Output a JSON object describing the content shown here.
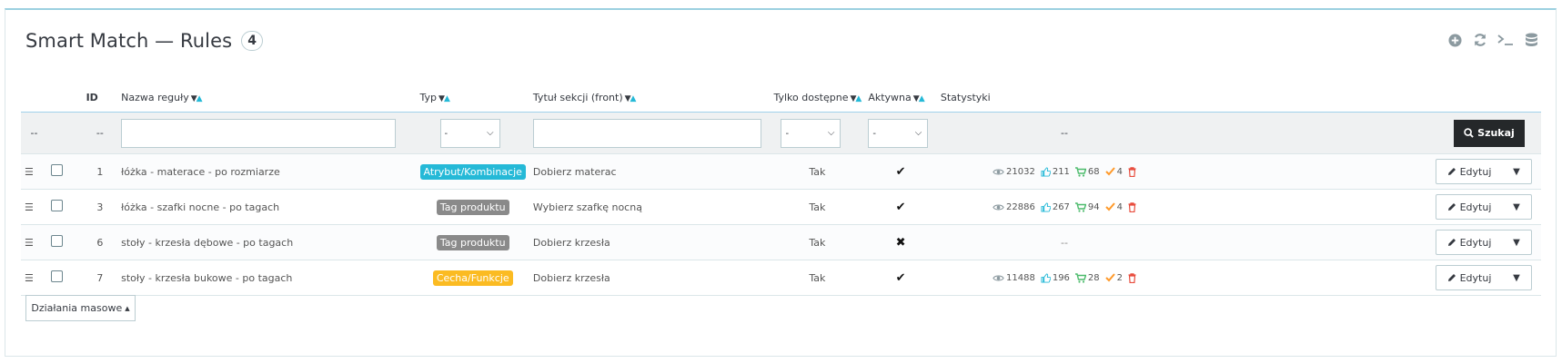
{
  "header": {
    "title": "Smart Match — Rules",
    "count": "4"
  },
  "toolbar": [
    "add-icon",
    "refresh-icon",
    "terminal-icon",
    "database-icon"
  ],
  "columns": {
    "id": "ID",
    "name": "Nazwa reguły",
    "type": "Typ",
    "section_title": "Tytuł sekcji (front)",
    "available_only": "Tylko dostępne",
    "active": "Aktywna",
    "stats": "Statystyki"
  },
  "filters": {
    "drag_placeholder": "--",
    "id_placeholder": "--",
    "type_value": "-",
    "available_value": "-",
    "active_value": "-",
    "stats_placeholder": "--",
    "search_label": "Szukaj"
  },
  "rows": [
    {
      "id": "1",
      "name": "łóżka - materace - po rozmiarze",
      "type": "Atrybut/Kombinacje",
      "type_color": "#25b9d7",
      "section_title": "Dobierz materac",
      "available_only": "Tak",
      "active": "✔",
      "views": "21032",
      "likes": "211",
      "cart": "68",
      "orders": "4",
      "empty_stats": ""
    },
    {
      "id": "3",
      "name": "łóżka - szafki nocne - po tagach",
      "type": "Tag produktu",
      "type_color": "#8a8a8a",
      "section_title": "Wybierz szafkę nocną",
      "available_only": "Tak",
      "active": "✔",
      "views": "22886",
      "likes": "267",
      "cart": "94",
      "orders": "4",
      "empty_stats": ""
    },
    {
      "id": "6",
      "name": "stoły - krzesła dębowe - po tagach",
      "type": "Tag produktu",
      "type_color": "#8a8a8a",
      "section_title": "Dobierz krzesła",
      "available_only": "Tak",
      "active": "✖",
      "views": "",
      "likes": "",
      "cart": "",
      "orders": "",
      "empty_stats": "--"
    },
    {
      "id": "7",
      "name": "stoły - krzesła bukowe - po tagach",
      "type": "Cecha/Funkcje",
      "type_color": "#fbbb22",
      "section_title": "Dobierz krzesła",
      "available_only": "Tak",
      "active": "✔",
      "views": "11488",
      "likes": "196",
      "cart": "28",
      "orders": "2",
      "empty_stats": ""
    }
  ],
  "row_actions": {
    "edit_label": "Edytuj"
  },
  "bulk": {
    "label": "Działania masowe"
  },
  "colors": {
    "accent": "#25b9d7",
    "danger": "#e84c3d",
    "success": "#4cbb6c",
    "orange": "#ff9a2b",
    "dark": "#25282a"
  }
}
